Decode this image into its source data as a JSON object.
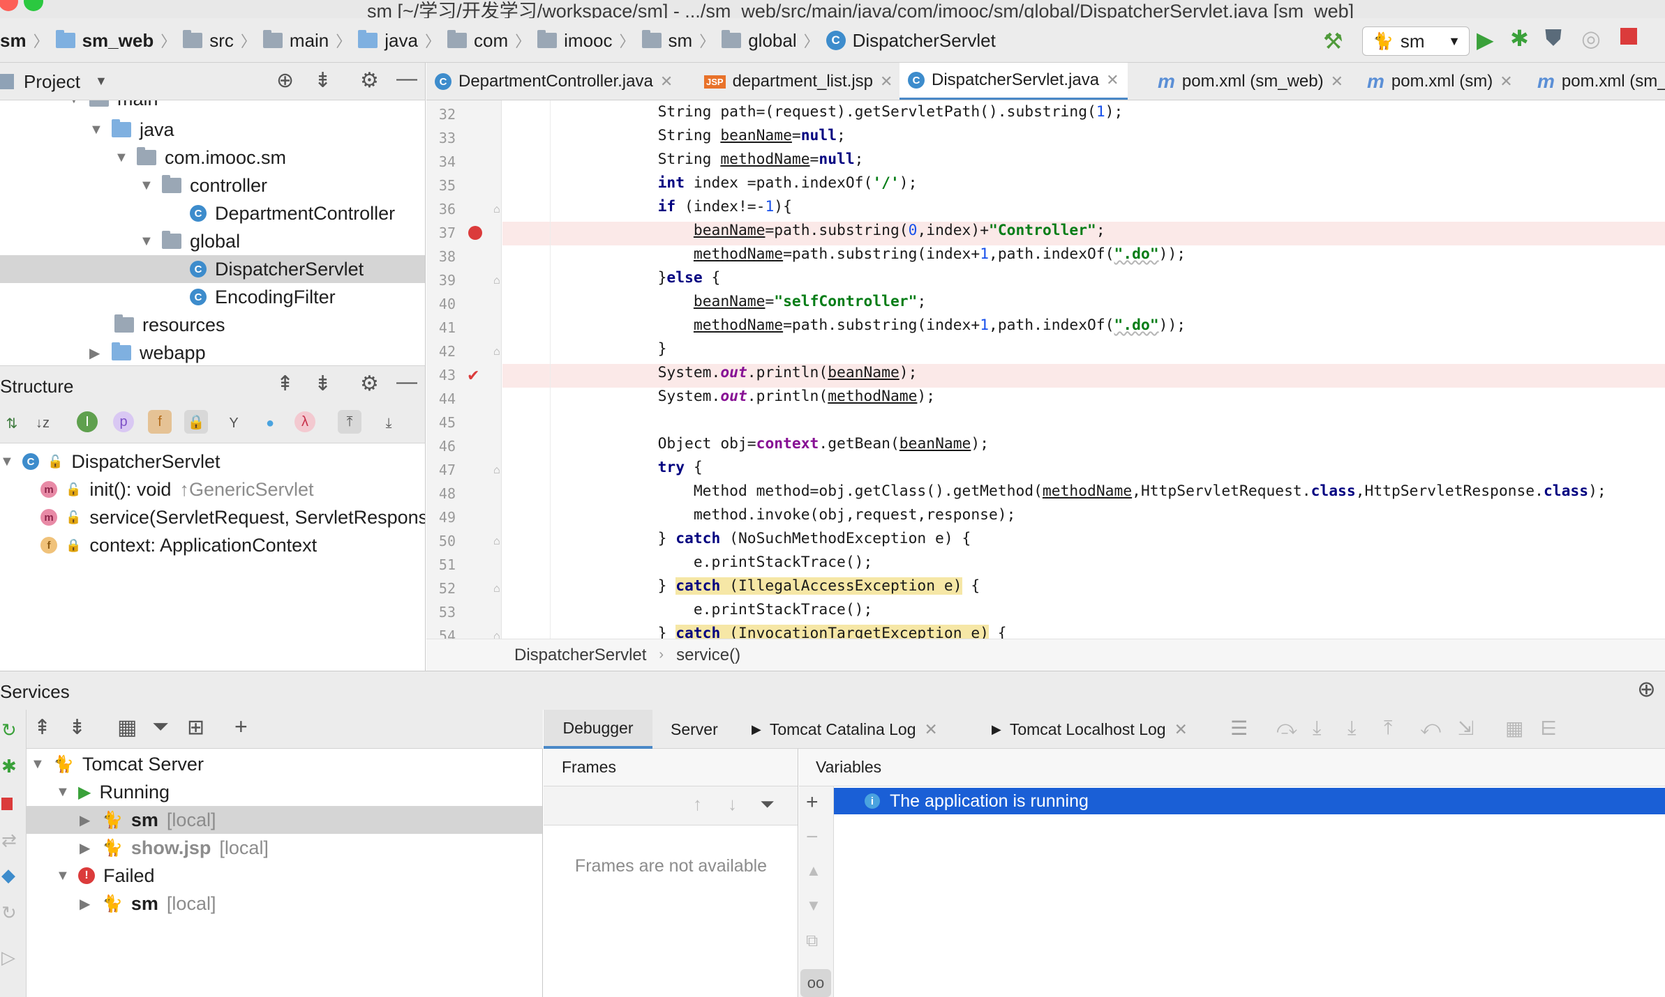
{
  "window": {
    "title": "sm [~/学习/开发学习/workspace/sm] - .../sm_web/src/main/java/com/imooc/sm/global/DispatcherServlet.java [sm_web]"
  },
  "breadcrumb": [
    "sm",
    "sm_web",
    "src",
    "main",
    "java",
    "com",
    "imooc",
    "sm",
    "global",
    "DispatcherServlet"
  ],
  "run_config": {
    "selected": "sm"
  },
  "project_panel": {
    "title": "Project",
    "tree": [
      {
        "label": "main",
        "depth": 0
      },
      {
        "label": "java",
        "depth": 1
      },
      {
        "label": "com.imooc.sm",
        "depth": 2
      },
      {
        "label": "controller",
        "depth": 3
      },
      {
        "label": "DepartmentController",
        "depth": 4
      },
      {
        "label": "global",
        "depth": 3
      },
      {
        "label": "DispatcherServlet",
        "depth": 4
      },
      {
        "label": "EncodingFilter",
        "depth": 4
      },
      {
        "label": "resources",
        "depth": 1
      },
      {
        "label": "webapp",
        "depth": 1
      }
    ]
  },
  "structure_panel": {
    "title": "Structure",
    "items": [
      {
        "label": "DispatcherServlet",
        "suffix": ""
      },
      {
        "label": "init(): void",
        "suffix": "↑GenericServlet"
      },
      {
        "label": "service(ServletRequest, ServletResponse)",
        "suffix": ""
      },
      {
        "label": "context: ApplicationContext",
        "suffix": ""
      }
    ]
  },
  "editor_tabs": [
    {
      "label": "DepartmentController.java",
      "icon": "class-icon"
    },
    {
      "label": "department_list.jsp",
      "icon": "jsp-icon"
    },
    {
      "label": "DispatcherServlet.java",
      "icon": "class-icon",
      "active": true
    },
    {
      "label": "pom.xml (sm_web)",
      "icon": "maven-icon"
    },
    {
      "label": "pom.xml (sm)",
      "icon": "maven-icon"
    },
    {
      "label": "pom.xml (sm_s",
      "icon": "maven-icon"
    }
  ],
  "editor": {
    "line_numbers": [
      "32",
      "33",
      "34",
      "35",
      "36",
      "37",
      "38",
      "39",
      "40",
      "41",
      "42",
      "43",
      "44",
      "45",
      "46",
      "47",
      "48",
      "49",
      "50",
      "51",
      "52",
      "53",
      "54"
    ],
    "breakpoint_lines": [
      "37",
      "43"
    ],
    "breadcrumb": [
      "DispatcherServlet",
      "service()"
    ]
  },
  "services": {
    "title": "Services",
    "tree": [
      {
        "label": "Tomcat Server",
        "suffix": ""
      },
      {
        "label": "Running",
        "suffix": ""
      },
      {
        "label": "sm",
        "suffix": "[local]"
      },
      {
        "label": "show.jsp",
        "suffix": "[local]"
      },
      {
        "label": "Failed",
        "suffix": ""
      },
      {
        "label": "sm",
        "suffix": "[local]"
      }
    ]
  },
  "debugger": {
    "tabs": [
      "Debugger",
      "Server",
      "Tomcat Catalina Log",
      "Tomcat Localhost Log"
    ],
    "frames_title": "Frames",
    "frames_empty": "Frames are not available",
    "variables_title": "Variables",
    "variables_message": "The application is running"
  },
  "colors": {
    "accent": "#4a88c7",
    "selection": "#1a5fd6",
    "breakpoint": "#db3b3b",
    "error_line": "#fbe9e8"
  }
}
